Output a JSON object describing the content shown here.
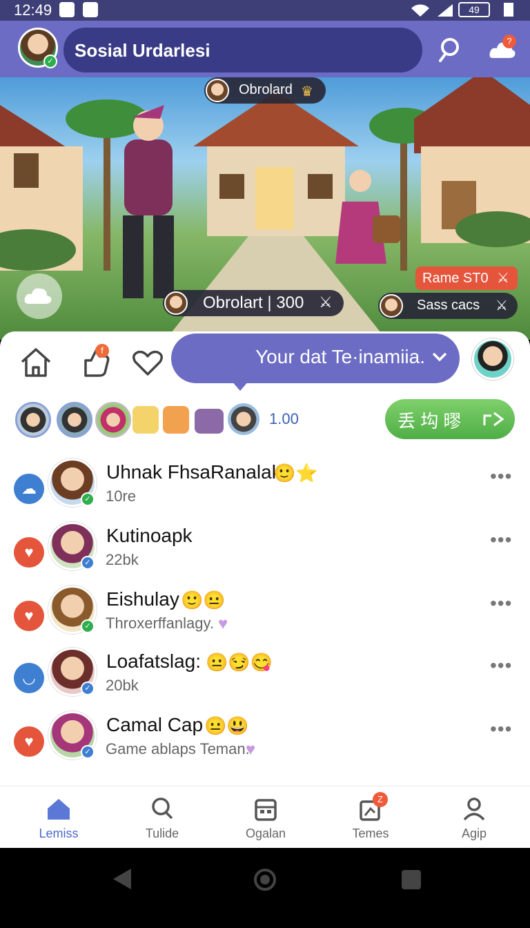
{
  "status_bar": {
    "time": "12:49",
    "battery": "49"
  },
  "header": {
    "title": "Sosial Urdarlesi",
    "notification_badge": "?"
  },
  "scene": {
    "top_pill": "Obrolard",
    "center_pill": "Obrolart | 300",
    "right_tag": "Rame ST0",
    "right_pill": "Sass cacs"
  },
  "top_nav": {
    "notification_badge": "f"
  },
  "bubble": {
    "text": "Your dat Te·inamiia."
  },
  "participants": {
    "count": "1.00"
  },
  "green_button": {
    "label": "丢 㘬 㬔"
  },
  "contacts": [
    {
      "name": "Uhnak FhsaRanalak",
      "subtitle": "10re",
      "icon_color": "#3f7fd1",
      "status_color": "#2eae4d"
    },
    {
      "name": "Kutinoapk",
      "subtitle": "22bk",
      "icon_color": "#e4553c",
      "status_color": "#3f7fd1"
    },
    {
      "name": "Eishulay",
      "subtitle": "Throxerffanlagy.",
      "icon_color": "#e4553c",
      "status_color": "#2eae4d"
    },
    {
      "name": "Loafatslag:",
      "subtitle": "20bk",
      "icon_color": "#3f7fd1",
      "status_color": "#3f7fd1"
    },
    {
      "name": "Camal Cap",
      "subtitle": "Game ablaps Teman.",
      "icon_color": "#e4553c",
      "status_color": "#3f7fd1"
    }
  ],
  "bottom_tabs": [
    {
      "label": "Lemiss",
      "icon": "home-icon",
      "active": true
    },
    {
      "label": "Tulide",
      "icon": "search-icon"
    },
    {
      "label": "Ogalan",
      "icon": "calendar-icon"
    },
    {
      "label": "Temes",
      "icon": "cards-icon",
      "badge": "Z"
    },
    {
      "label": "Agip",
      "icon": "user-icon"
    }
  ],
  "colors": {
    "accent": "#6c6cc4",
    "header_dark": "#3a3b86",
    "green": "#4fae47"
  }
}
